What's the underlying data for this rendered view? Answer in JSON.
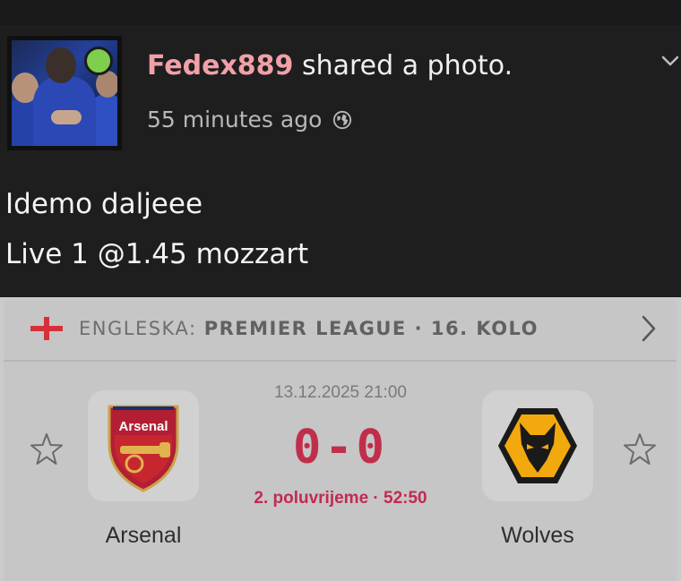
{
  "post": {
    "username": "Fedex889",
    "action": " shared a photo.",
    "time": "55 minutes ago",
    "text_lines": [
      "Idemo daljeee",
      "Live 1 @1.45 mozzart"
    ]
  },
  "match": {
    "league_prefix": "ENGLESKA: ",
    "league_name": "PREMIER LEAGUE · 16. KOLO",
    "datetime": "13.12.2025 21:00",
    "score": "0-0",
    "status": "2. poluvrijeme · 52:50",
    "home_team": "Arsenal",
    "home_crest_text": "Arsenal",
    "away_team": "Wolves"
  },
  "colors": {
    "username": "#f2a0a8",
    "score": "#c12e4c",
    "online": "#7fce4e"
  },
  "icons": [
    "globe-icon",
    "chevron-down-icon",
    "england-flag-icon",
    "chevron-right-icon",
    "star-icon"
  ]
}
